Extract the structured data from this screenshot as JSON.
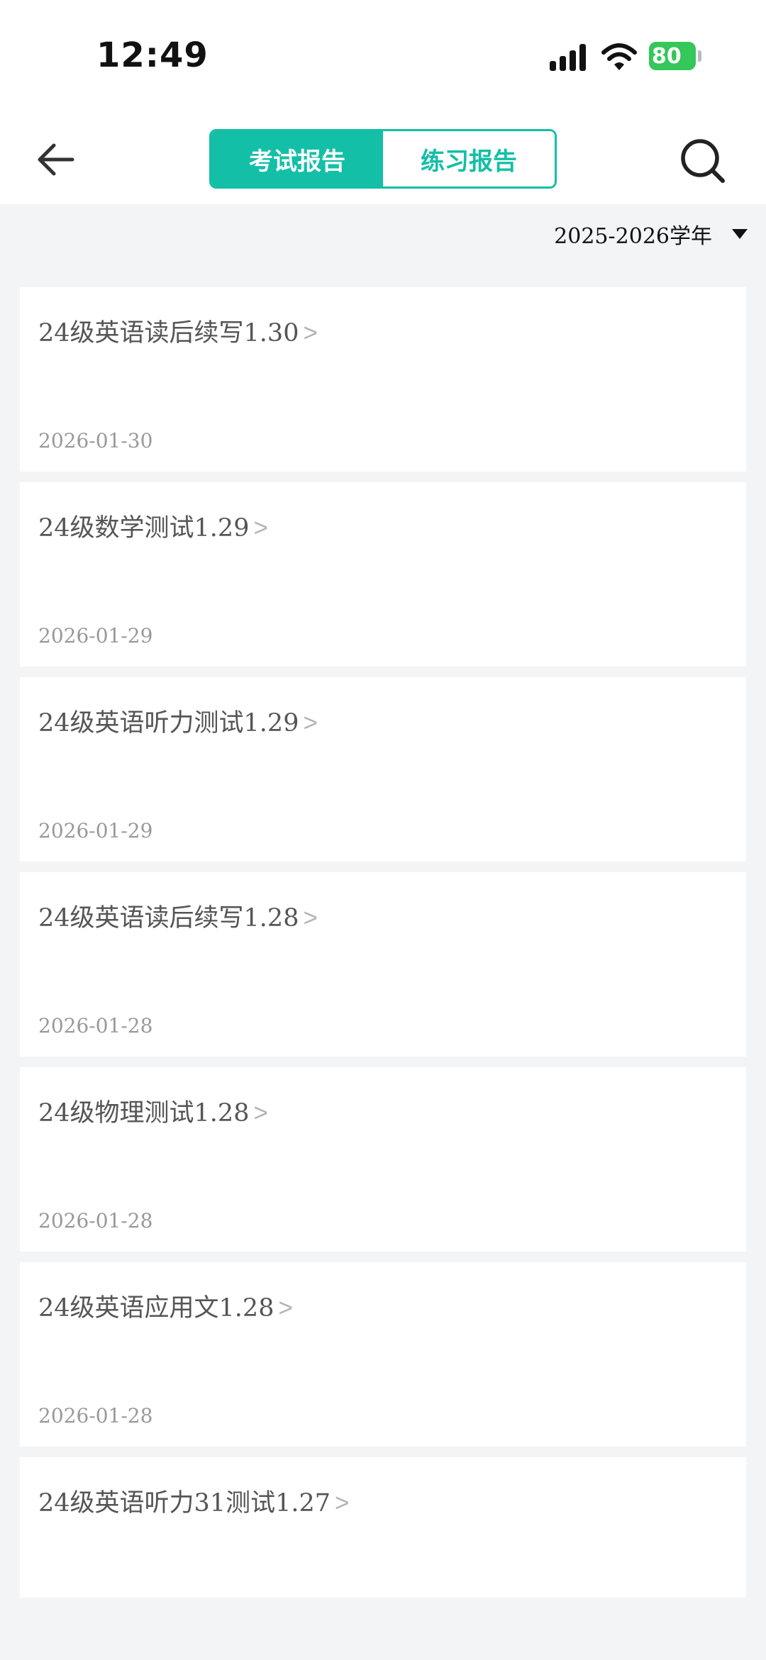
{
  "status_bar": {
    "time": "12:49",
    "battery": "80"
  },
  "header": {
    "tabs": [
      {
        "label": "考试报告",
        "active": true
      },
      {
        "label": "练习报告",
        "active": false
      }
    ]
  },
  "filter": {
    "year": "2025-2026学年"
  },
  "reports": [
    {
      "title": "24级英语读后续写1.30",
      "date": "2026-01-30"
    },
    {
      "title": "24级数学测试1.29",
      "date": "2026-01-29"
    },
    {
      "title": "24级英语听力测试1.29",
      "date": "2026-01-29"
    },
    {
      "title": "24级英语读后续写1.28",
      "date": "2026-01-28"
    },
    {
      "title": "24级物理测试1.28",
      "date": "2026-01-28"
    },
    {
      "title": "24级英语应用文1.28",
      "date": "2026-01-28"
    },
    {
      "title": "24级英语听力31测试1.27",
      "date": ""
    }
  ],
  "colors": {
    "accent": "#13bfa6",
    "battery": "#34c759"
  },
  "icons": [
    "back-arrow-icon",
    "search-icon",
    "caret-down-icon",
    "cellular-signal-icon",
    "wifi-icon",
    "battery-icon"
  ]
}
